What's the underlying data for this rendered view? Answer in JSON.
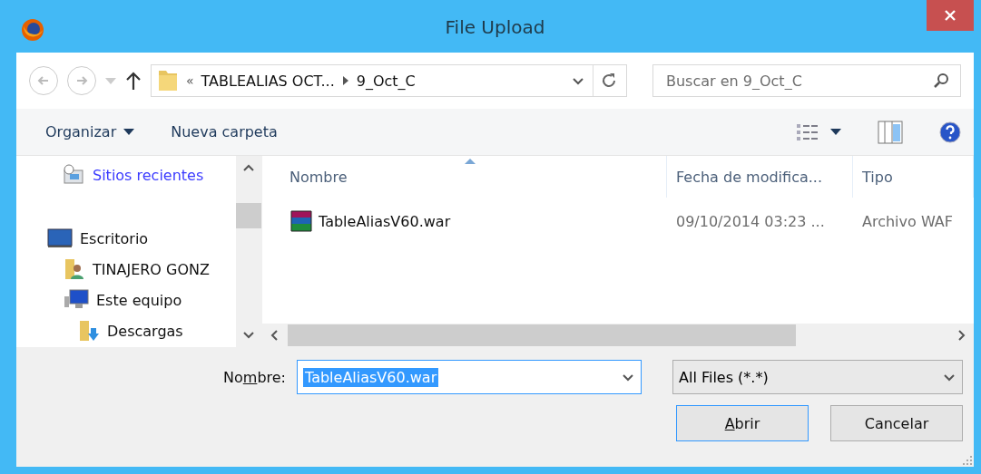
{
  "window": {
    "title": "File Upload"
  },
  "nav": {
    "overflow": "«",
    "path": [
      {
        "text": "TABLEALIAS OCT..."
      },
      {
        "text": "9_Oct_C"
      }
    ],
    "search": {
      "placeholder": "Buscar en 9_Oct_C"
    }
  },
  "toolbar": {
    "items": [
      {
        "label": "Organizar",
        "dropdown": true
      },
      {
        "label": "Nueva carpeta",
        "dropdown": false
      }
    ]
  },
  "sidebar": {
    "items": [
      {
        "label": "Sitios recientes",
        "kind": "recent",
        "hovered": true
      },
      {
        "label": "Escritorio",
        "kind": "desktop",
        "hovered": false,
        "children": [
          {
            "label": "TINAJERO GONZ",
            "kind": "user",
            "hovered": false
          },
          {
            "label": "Este equipo",
            "kind": "computer",
            "hovered": false,
            "children": [
              {
                "label": "Descargas",
                "kind": "downloads",
                "hovered": false
              }
            ]
          }
        ]
      }
    ]
  },
  "table": {
    "columns": [
      {
        "label": "Nombre",
        "sorted": true
      },
      {
        "label": "Fecha de modifica...",
        "sorted": false
      },
      {
        "label": "Tipo",
        "sorted": false
      }
    ],
    "rows": [
      {
        "name": "TableAliasV60.war",
        "date": "09/10/2014 03:23 ...",
        "type": "Archivo WAF"
      }
    ]
  },
  "footer": {
    "name_label": {
      "pre": "No",
      "key": "m",
      "post": "bre:"
    },
    "name_value": "TableAliasV60.war",
    "filter": "All Files (*.*)",
    "buttons": [
      {
        "key": "A",
        "post": "brir",
        "default": true
      },
      {
        "pre": "Cancelar",
        "default": false
      }
    ]
  }
}
